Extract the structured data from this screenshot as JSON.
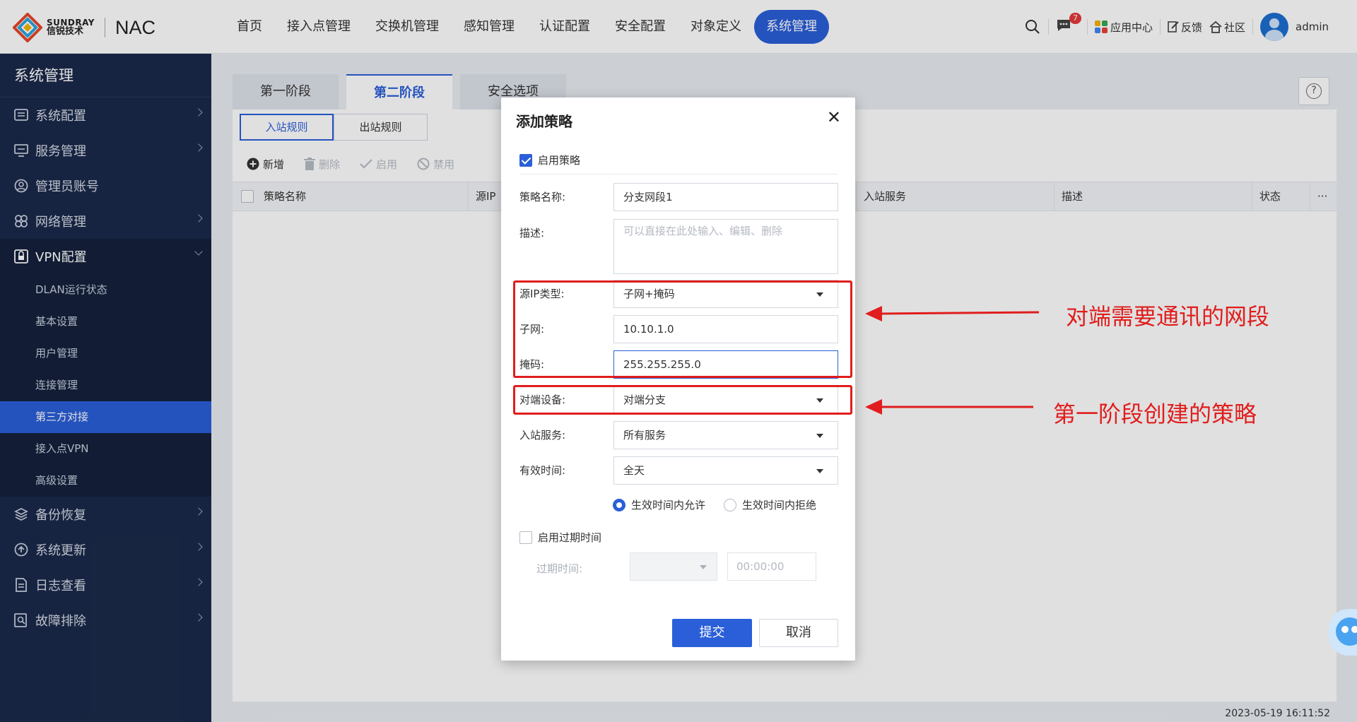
{
  "brand": {
    "en": "SUNDRAY",
    "cn": "信锐技术",
    "product": "NAC"
  },
  "main_nav": [
    "首页",
    "接入点管理",
    "交换机管理",
    "感知管理",
    "认证配置",
    "安全配置",
    "对象定义",
    "系统管理"
  ],
  "main_nav_active": "系统管理",
  "top_right": {
    "message_badge": "7",
    "app_center": "应用中心",
    "feedback": "反馈",
    "community": "社区",
    "user": "admin"
  },
  "sidebar": {
    "title": "系统管理",
    "items": [
      {
        "label": "系统配置",
        "icon": "list-icon"
      },
      {
        "label": "服务管理",
        "icon": "server-icon"
      },
      {
        "label": "管理员账号",
        "icon": "user-circle-icon"
      },
      {
        "label": "网络管理",
        "icon": "network-icon"
      },
      {
        "label": "VPN配置",
        "icon": "vpn-icon"
      },
      {
        "label": "备份恢复",
        "icon": "layers-icon"
      },
      {
        "label": "系统更新",
        "icon": "upload-icon"
      },
      {
        "label": "日志查看",
        "icon": "document-icon"
      },
      {
        "label": "故障排除",
        "icon": "search-doc-icon"
      }
    ],
    "vpn_sub": [
      "DLAN运行状态",
      "基本设置",
      "用户管理",
      "连接管理",
      "第三方对接",
      "接入点VPN",
      "高级设置"
    ],
    "vpn_sub_active": "第三方对接"
  },
  "tabs": [
    "第一阶段",
    "第二阶段",
    "安全选项"
  ],
  "tab_active": "第二阶段",
  "subtabs": [
    "入站规则",
    "出站规则"
  ],
  "subtab_active": "入站规则",
  "toolbar": {
    "add": "新增",
    "delete": "删除",
    "enable": "启用",
    "disable": "禁用"
  },
  "table_headers": [
    "策略名称",
    "源IP",
    "入站服务",
    "描述",
    "状态",
    "···"
  ],
  "timestamp": "2023-05-19 16:11:52",
  "dialog": {
    "title": "添加策略",
    "enable_policy": "启用策略",
    "name_label": "策略名称:",
    "name_value": "分支网段1",
    "desc_label": "描述:",
    "desc_placeholder": "可以直接在此处输入、编辑、删除",
    "src_type_label": "源IP类型:",
    "src_type_value": "子网+掩码",
    "subnet_label": "子网:",
    "subnet_value": "10.10.1.0",
    "mask_label": "掩码:",
    "mask_value": "255.255.255.0",
    "peer_label": "对端设备:",
    "peer_value": "对端分支",
    "inbound_label": "入站服务:",
    "inbound_value": "所有服务",
    "time_label": "有效时间:",
    "time_value": "全天",
    "radio_allow": "生效时间内允许",
    "radio_deny": "生效时间内拒绝",
    "expire_enable": "启用过期时间",
    "expire_label": "过期时间:",
    "expire_time": "00:00:00",
    "submit": "提交",
    "cancel": "取消"
  },
  "annotations": {
    "subnet_note": "对端需要通讯的网段",
    "peer_note": "第一阶段创建的策略"
  },
  "colors": {
    "primary": "#2b5fd9",
    "sidebar_bg": "#1b2a4a",
    "annotation": "#e11d1d"
  }
}
